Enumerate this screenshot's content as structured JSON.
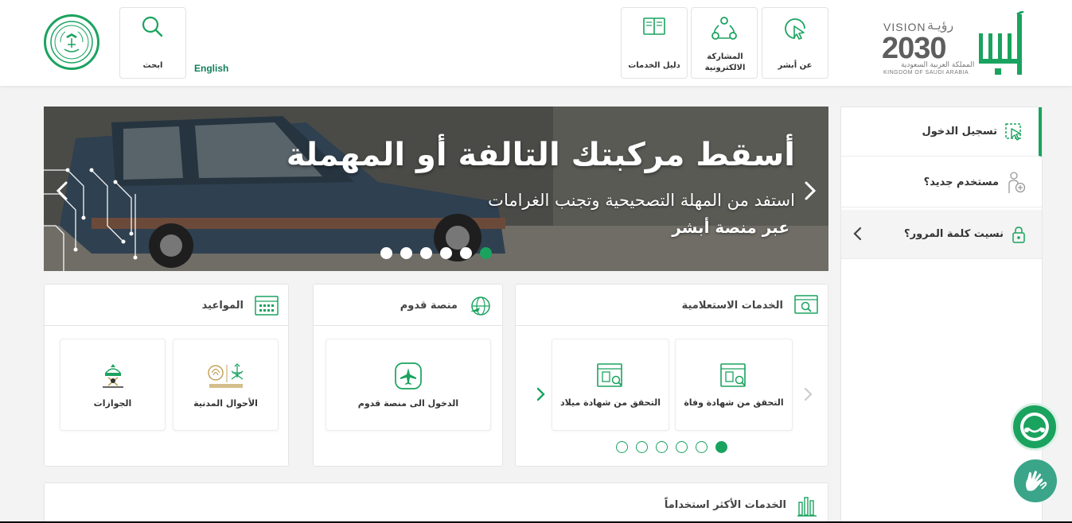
{
  "header": {
    "nav": [
      {
        "label": "عن أبشر",
        "icon": "pointer-icon"
      },
      {
        "label": "المشاركة الالكترونية",
        "icon": "network-icon"
      },
      {
        "label": "دليل الخدمات",
        "icon": "book-icon"
      }
    ],
    "search_label": "ابحث",
    "language_link": "English",
    "vision_text": "VISION",
    "vision_ar": "رؤيـة",
    "vision_year": "2030",
    "kingdom_ar": "المملكة العربية السعودية",
    "kingdom_en": "KINGDOM OF SAUDI ARABIA",
    "brand_color": "#1aa35f"
  },
  "sidebar": {
    "items": [
      {
        "label": "تسجيل الدخول",
        "icon": "login-cursor-icon"
      },
      {
        "label": "مستخدم جديد؟",
        "icon": "add-user-icon"
      },
      {
        "label": "نسيت كلمة المرور؟",
        "icon": "lock-icon"
      }
    ]
  },
  "hero": {
    "title": "أسقط مركبتك التالفة أو المهملة",
    "subtitle": "استفد من المهلة التصحيحية وتجنب الغرامات",
    "subtitle2": "عبر منصة أبشر",
    "slides_total": 6,
    "active_slide": 6
  },
  "cards": {
    "inquiry": {
      "title": "الخدمات الاستعلامية",
      "tiles": [
        {
          "label": "التحقق من شهادة وفاة",
          "icon": "certificate-search-icon"
        },
        {
          "label": "التحقق من شهادة ميلاد",
          "icon": "certificate-search-icon"
        }
      ],
      "pages_total": 6,
      "active_page": 6
    },
    "arrival": {
      "title": "منصة قدوم",
      "tiles": [
        {
          "label": "الدخول الى منصة قدوم",
          "icon": "airplane-icon"
        }
      ]
    },
    "appointments": {
      "title": "المواعيد",
      "tiles": [
        {
          "label": "الأحوال المدنية",
          "icon": "civil-affairs-logo"
        },
        {
          "label": "الجوازات",
          "icon": "passports-logo"
        }
      ]
    }
  },
  "most_used": {
    "title": "الخدمات الأكثر استخداماً"
  }
}
